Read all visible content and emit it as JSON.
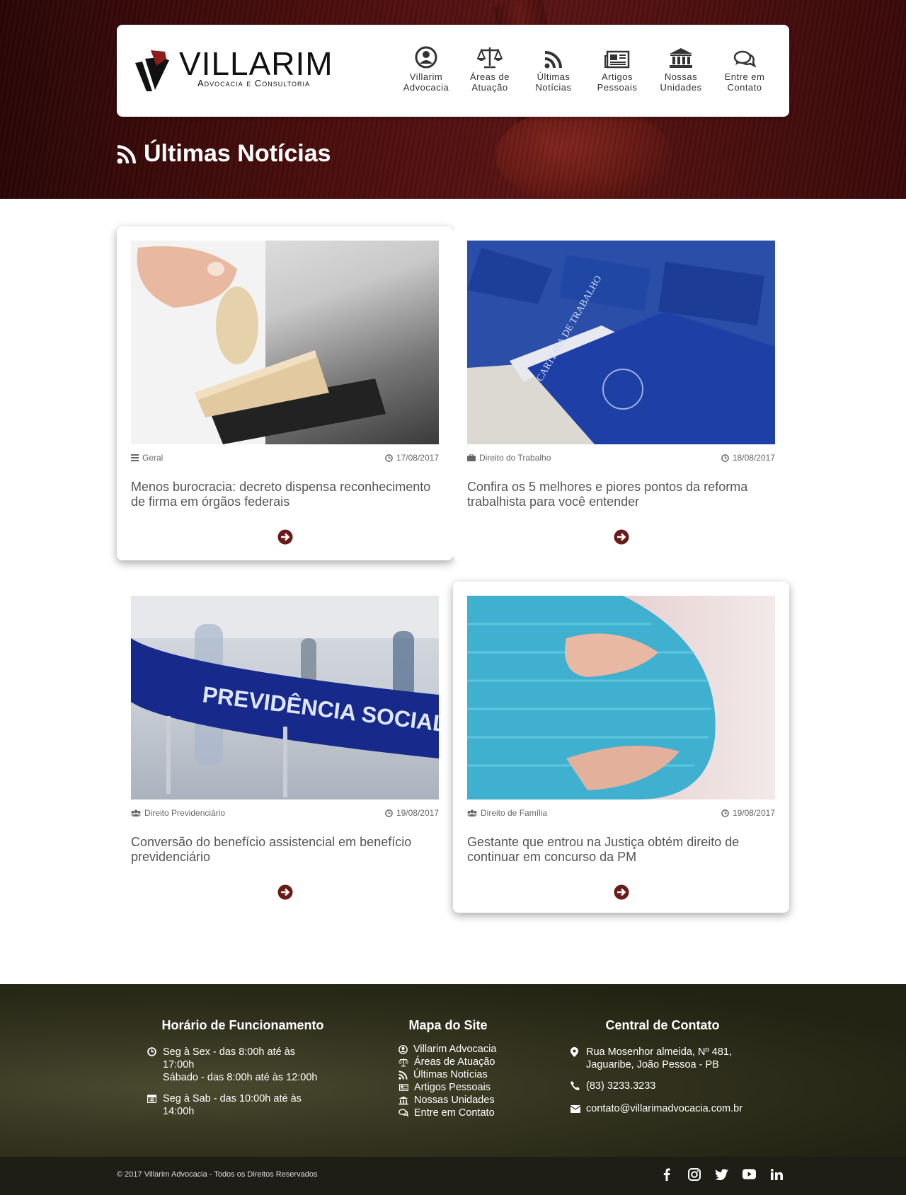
{
  "header": {
    "logo_name": "VILLARIM",
    "logo_subtitle": "Advocacia e Consultoria",
    "nav": [
      {
        "label": "Villarim\nAdvocacia",
        "icon": "user-circle-icon"
      },
      {
        "label": "Áreas de\nAtuação",
        "icon": "scales-icon"
      },
      {
        "label": "Últimas\nNotícias",
        "icon": "rss-icon"
      },
      {
        "label": "Artigos\nPessoais",
        "icon": "newspaper-icon"
      },
      {
        "label": "Nossas\nUnidades",
        "icon": "bank-icon"
      },
      {
        "label": "Entre em\nContato",
        "icon": "chat-icon"
      }
    ]
  },
  "page_title": "Últimas Notícias",
  "news": [
    {
      "category": "Geral",
      "category_icon": "list-icon",
      "date": "17/08/2017",
      "title": "Menos burocracia: decreto dispensa reconhecimento de firma em órgãos federais",
      "image": "stamp-photo"
    },
    {
      "category": "Direito do Trabalho",
      "category_icon": "briefcase-icon",
      "date": "18/08/2017",
      "title": "Confira os 5 melhores e piores pontos da reforma trabalhista para você entender",
      "image": "work-card-photo"
    },
    {
      "category": "Direito Previdenciário",
      "category_icon": "users-icon",
      "date": "19/08/2017",
      "title": "Conversão do benefício assistencial em benefício previdenciário",
      "image": "social-security-photo"
    },
    {
      "category": "Direito de Família",
      "category_icon": "users-icon",
      "date": "19/08/2017",
      "title": "Gestante que entrou na Justiça obtém direito de continuar em concurso da PM",
      "image": "pregnant-photo"
    }
  ],
  "footer": {
    "hours": {
      "title": "Horário de Funcionamento",
      "weekdays": "Seg à Sex - das 8:00h até às 17:00h",
      "saturday": "Sábado - das 8:00h até às 12:00h",
      "alt": "Seg à Sab - das 10:00h até às 14:00h"
    },
    "sitemap": {
      "title": "Mapa do Site",
      "links": [
        "Villarim Advocacia",
        "Áreas de Atuação",
        "Últimas Notícias",
        "Artigos Pessoais",
        "Nossas Unidades",
        "Entre em Contato"
      ]
    },
    "contact": {
      "title": "Central de Contato",
      "address": "Rua Mosenhor almeida, Nº 481, Jaguaribe, João Pessoa - PB",
      "phone": "(83) 3233.3233",
      "email": "contato@villarimadvocacia.com.br"
    },
    "copyright": "© 2017 Villarim Advocacia - Todos os Direitos Reservados"
  },
  "colors": {
    "accent": "#6b1a1a",
    "hero": "#4a0d0d",
    "footer": "#2e2e1c"
  }
}
